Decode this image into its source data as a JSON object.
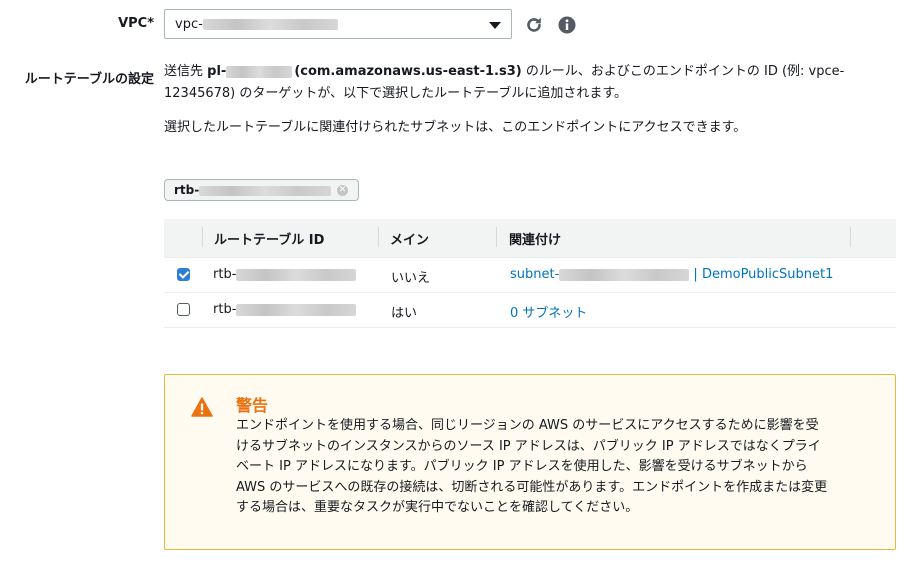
{
  "vpc": {
    "label": "VPC*",
    "select_value_prefix": "vpc-",
    "colors": {
      "border": "#aab7b8"
    }
  },
  "icons": {
    "refresh": "refresh-icon",
    "info": "info-icon",
    "warning": "warning-icon"
  },
  "route_tables": {
    "label": "ルートテーブルの設定",
    "desc_prefix": "送信先 ",
    "desc_pl": "pl-",
    "desc_service": "(com.amazonaws.us-east-1.s3)",
    "desc_rest": " のルール、およびこのエンドポイントの ID (例: vpce-12345678) のターゲットが、以下で選択したルートテーブルに追加されます。",
    "desc_line2": "選択したルートテーブルに関連付けられたサブネットは、このエンドポイントにアクセスできます。",
    "token_prefix": "rtb-",
    "table": {
      "headers": [
        "ルートテーブル ID",
        "メイン",
        "関連付け"
      ],
      "rows": [
        {
          "checked": true,
          "id_prefix": "rtb-",
          "main": "いいえ",
          "assoc_prefix": "subnet-",
          "assoc_suffix": " | DemoPublicSubnet1"
        },
        {
          "checked": false,
          "id_prefix": "rtb-",
          "main": "はい",
          "assoc_link": "0 サブネット"
        }
      ]
    }
  },
  "warning": {
    "title": "警告",
    "lines": [
      "エンドポイントを使用する場合、同じリージョンの AWS のサービスにアクセスするために影響を受",
      "けるサブネットのインスタンスからのソース IP アドレスは、パブリック IP アドレスではなくプライ",
      "ベート IP アドレスになります。パブリック IP アドレスを使用した、影響を受けるサブネットから",
      "AWS のサービスへの既存の接続は、切断される可能性があります。エンドポイントを作成または変更",
      "する場合は、重要なタスクが実行中でないことを確認してください。"
    ],
    "colors": {
      "title": "#ec7211",
      "border": "#e6b73e",
      "background": "#fffbf0"
    }
  },
  "colors": {
    "link": "#0073bb",
    "checkbox": "#2f7dd6"
  }
}
